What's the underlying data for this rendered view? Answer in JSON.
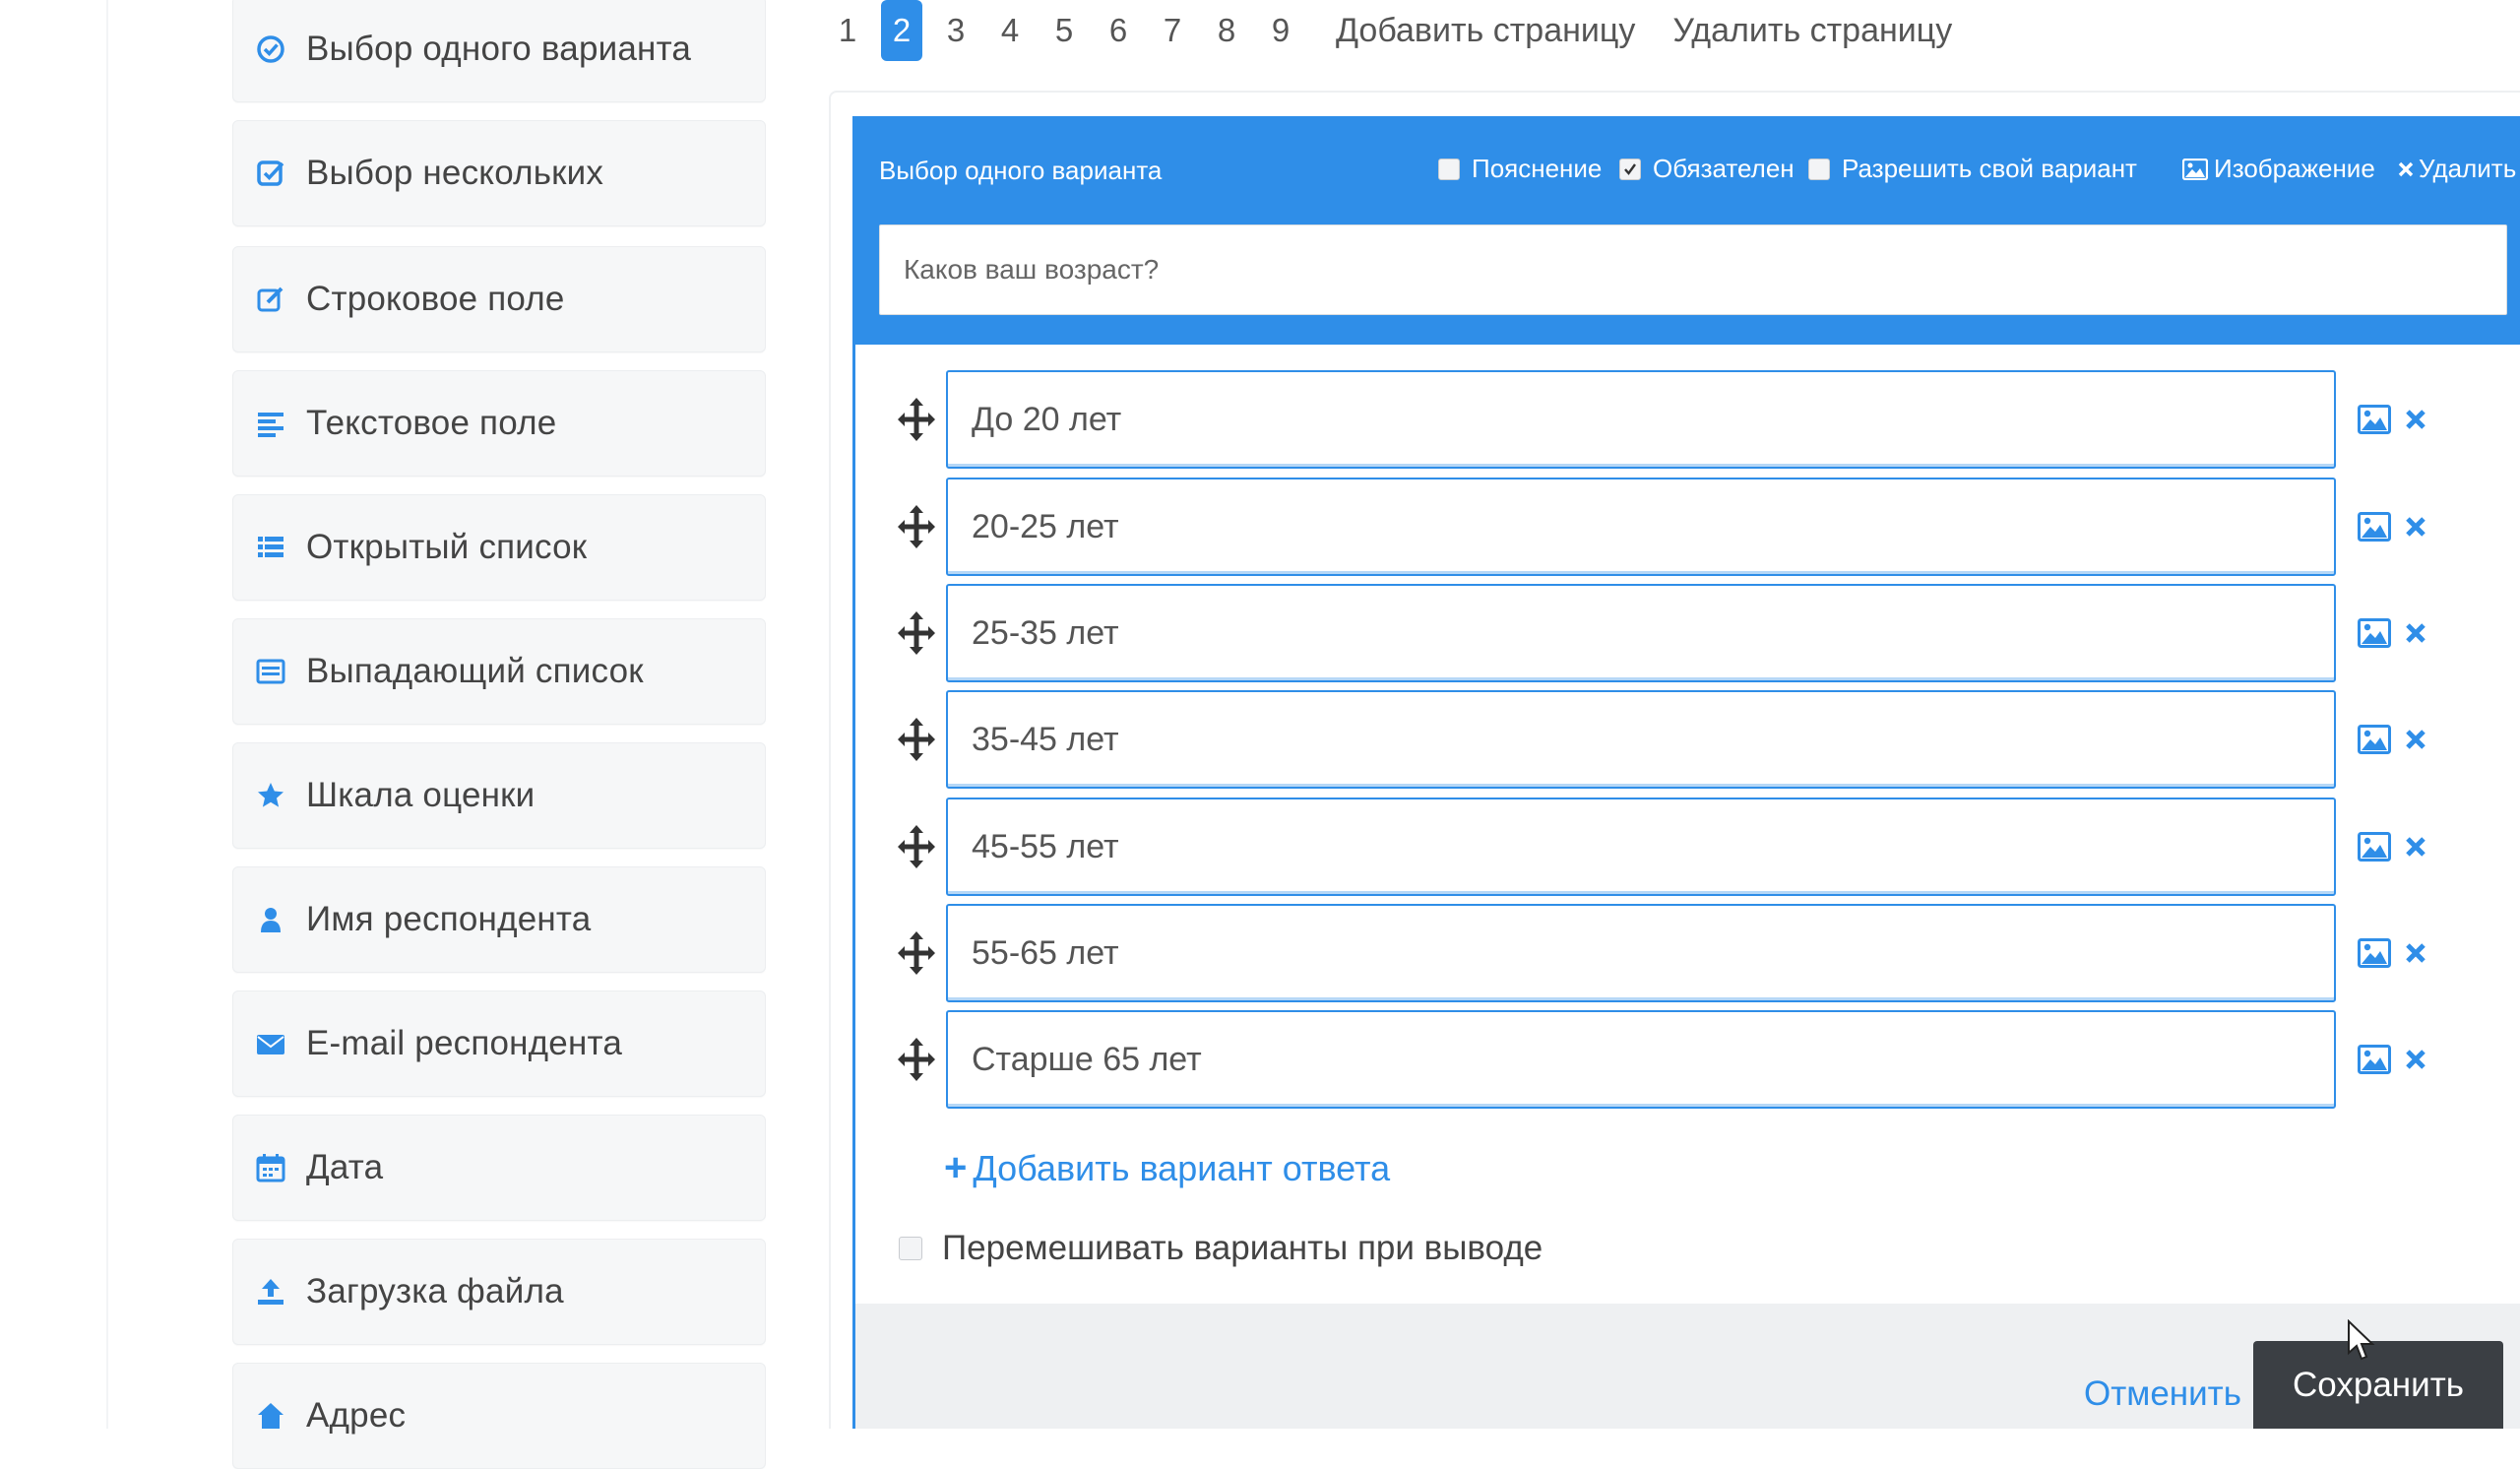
{
  "sidebar": {
    "items": [
      {
        "label": "Выбор одного варианта",
        "icon": "radio-check-icon"
      },
      {
        "label": "Выбор нескольких",
        "icon": "checkbox-icon"
      },
      {
        "label": "Строковое поле",
        "icon": "edit-icon"
      },
      {
        "label": "Текстовое поле",
        "icon": "align-left-icon"
      },
      {
        "label": "Открытый список",
        "icon": "list-icon"
      },
      {
        "label": "Выпадающий список",
        "icon": "dropdown-list-icon"
      },
      {
        "label": "Шкала оценки",
        "icon": "star-icon"
      },
      {
        "label": "Имя респондента",
        "icon": "user-icon"
      },
      {
        "label": "E-mail респондента",
        "icon": "envelope-icon"
      },
      {
        "label": "Дата",
        "icon": "calendar-icon"
      },
      {
        "label": "Загрузка файла",
        "icon": "upload-icon"
      },
      {
        "label": "Адрес",
        "icon": "address-icon"
      }
    ]
  },
  "pagination": {
    "pages": [
      "1",
      "2",
      "3",
      "4",
      "5",
      "6",
      "7",
      "8",
      "9"
    ],
    "active": "2",
    "add_page": "Добавить страницу",
    "delete_page": "Удалить страницу"
  },
  "editor": {
    "title": "Выбор одного варианта",
    "options": {
      "explanation": "Пояснение",
      "required": "Обязателен",
      "allow_own": "Разрешить свой вариант",
      "image": "Изображение",
      "delete": "Удалить"
    },
    "option_states": {
      "explanation": false,
      "required": true,
      "allow_own": false
    },
    "question": "Каков ваш возраст?",
    "answers": [
      "До 20 лет",
      "20-25 лет",
      "25-35 лет",
      "35-45 лет",
      "45-55 лет",
      "55-65 лет",
      "Старше 65 лет"
    ],
    "add_answer": "Добавить вариант ответа",
    "shuffle_label": "Перемешивать варианты при выводе",
    "cancel": "Отменить",
    "save": "Сохранить"
  },
  "colors": {
    "accent": "#2f8ee8",
    "save_button": "#3b3f44",
    "footer_bg": "#eef0f2",
    "sidebar_bg": "#f6f7f8"
  }
}
